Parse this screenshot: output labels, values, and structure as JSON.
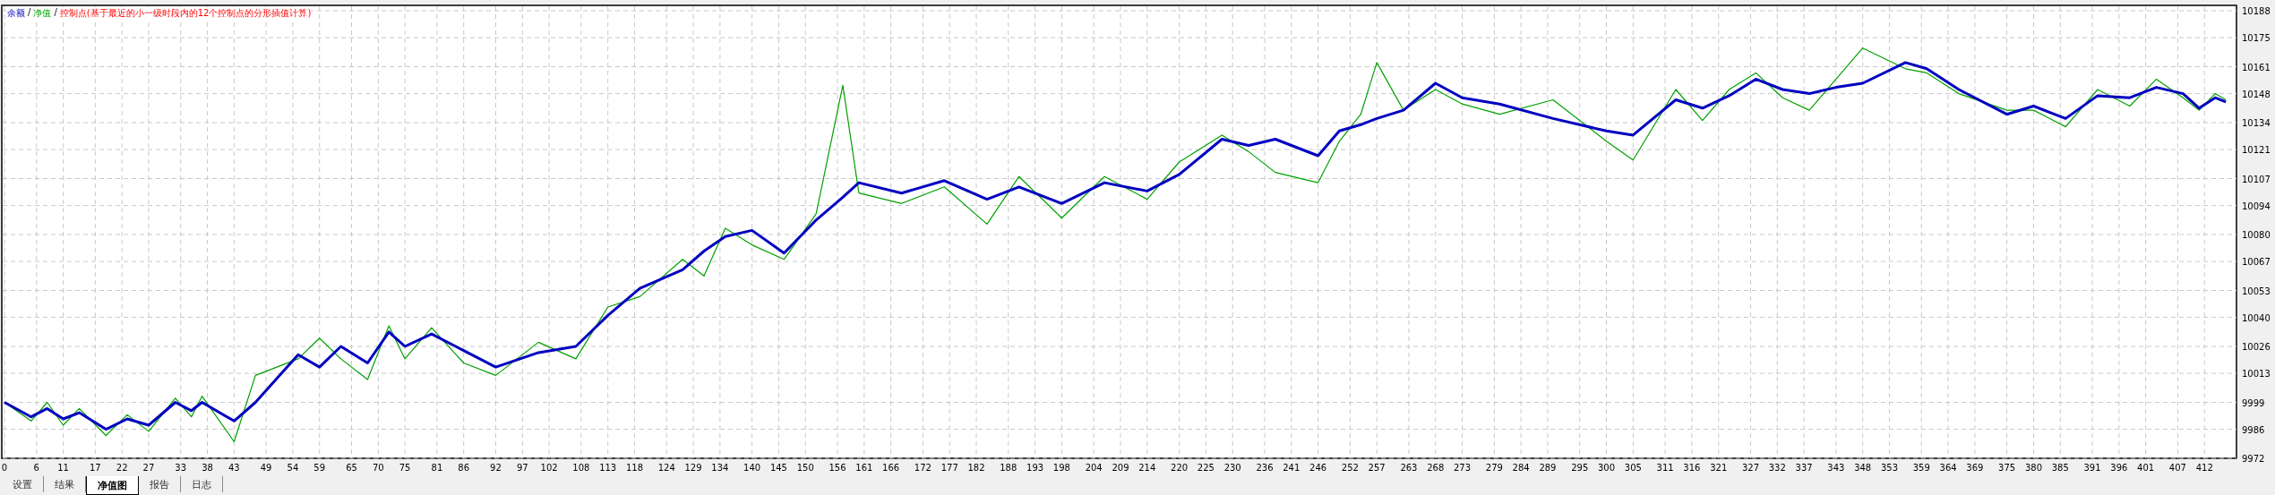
{
  "chart": {
    "legend_note": "控制点(基于最近的小一级时段内的12个控制点的分形插值计算)",
    "legend_separator": "/",
    "chart_data": {
      "type": "line",
      "grid": true,
      "x": [
        0,
        5,
        8,
        11,
        14,
        19,
        23,
        27,
        32,
        35,
        37,
        43,
        47,
        55,
        59,
        63,
        68,
        72,
        75,
        80,
        86,
        92,
        100,
        107,
        113,
        119,
        127,
        131,
        135,
        140,
        146,
        152,
        157,
        160,
        168,
        176,
        184,
        190,
        198,
        206,
        214,
        220,
        228,
        233,
        238,
        246,
        250,
        254,
        257,
        262,
        268,
        273,
        280,
        290,
        300,
        305,
        313,
        318,
        323,
        328,
        333,
        338,
        343,
        348,
        356,
        360,
        366,
        375,
        380,
        386,
        392,
        398,
        403,
        408,
        411,
        414,
        416
      ],
      "series": [
        {
          "name": "余额",
          "color": "#0000c0",
          "values": [
            9999,
            9992,
            9996,
            9991,
            9994,
            9986,
            9991,
            9988,
            9999,
            9995,
            9999,
            9990,
            9999,
            10022,
            10016,
            10026,
            10018,
            10033,
            10026,
            10032,
            10024,
            10016,
            10023,
            10026,
            10041,
            10054,
            10063,
            10072,
            10079,
            10082,
            10071,
            10087,
            10098,
            10105,
            10100,
            10106,
            10097,
            10103,
            10095,
            10105,
            10101,
            10109,
            10126,
            10123,
            10126,
            10118,
            10130,
            10133,
            10136,
            10140,
            10153,
            10146,
            10143,
            10136,
            10130,
            10128,
            10145,
            10141,
            10147,
            10155,
            10150,
            10148,
            10151,
            10153,
            10163,
            10160,
            10150,
            10138,
            10142,
            10136,
            10147,
            10146,
            10151,
            10148,
            10141,
            10146,
            10144
          ]
        },
        {
          "name": "净值",
          "color": "#00a000",
          "values": [
            9999,
            9990,
            9999,
            9988,
            9996,
            9983,
            9993,
            9985,
            10001,
            9992,
            10002,
            9980,
            10012,
            10020,
            10030,
            10020,
            10010,
            10036,
            10020,
            10035,
            10018,
            10012,
            10028,
            10020,
            10045,
            10050,
            10068,
            10060,
            10083,
            10075,
            10068,
            10090,
            10152,
            10100,
            10095,
            10103,
            10085,
            10108,
            10088,
            10108,
            10097,
            10115,
            10128,
            10120,
            10110,
            10105,
            10125,
            10138,
            10163,
            10140,
            10150,
            10143,
            10138,
            10145,
            10125,
            10116,
            10150,
            10135,
            10150,
            10158,
            10146,
            10140,
            10155,
            10170,
            10160,
            10158,
            10148,
            10140,
            10140,
            10132,
            10150,
            10142,
            10155,
            10146,
            10140,
            10148,
            10145
          ]
        }
      ],
      "xlim": [
        0,
        418
      ],
      "ylim": [
        9972,
        10188
      ],
      "xticks": [
        0,
        6,
        11,
        17,
        22,
        27,
        33,
        38,
        43,
        49,
        54,
        59,
        65,
        70,
        75,
        81,
        86,
        92,
        97,
        102,
        108,
        113,
        118,
        124,
        129,
        134,
        140,
        145,
        150,
        156,
        161,
        166,
        172,
        177,
        182,
        188,
        193,
        198,
        204,
        209,
        214,
        220,
        225,
        230,
        236,
        241,
        246,
        252,
        257,
        263,
        268,
        273,
        279,
        284,
        289,
        295,
        300,
        305,
        311,
        316,
        321,
        327,
        332,
        337,
        343,
        348,
        353,
        359,
        364,
        369,
        375,
        380,
        385,
        391,
        396,
        401,
        407,
        412
      ],
      "yticks": [
        9972,
        9986,
        9999,
        10013,
        10026,
        10040,
        10053,
        10067,
        10080,
        10094,
        10107,
        10121,
        10134,
        10148,
        10161,
        10175,
        10188
      ]
    }
  },
  "tabs": [
    {
      "label": "设置",
      "selected": false
    },
    {
      "label": "结果",
      "selected": false
    },
    {
      "label": "净值图",
      "selected": true
    },
    {
      "label": "报告",
      "selected": false
    },
    {
      "label": "日志",
      "selected": false
    }
  ]
}
